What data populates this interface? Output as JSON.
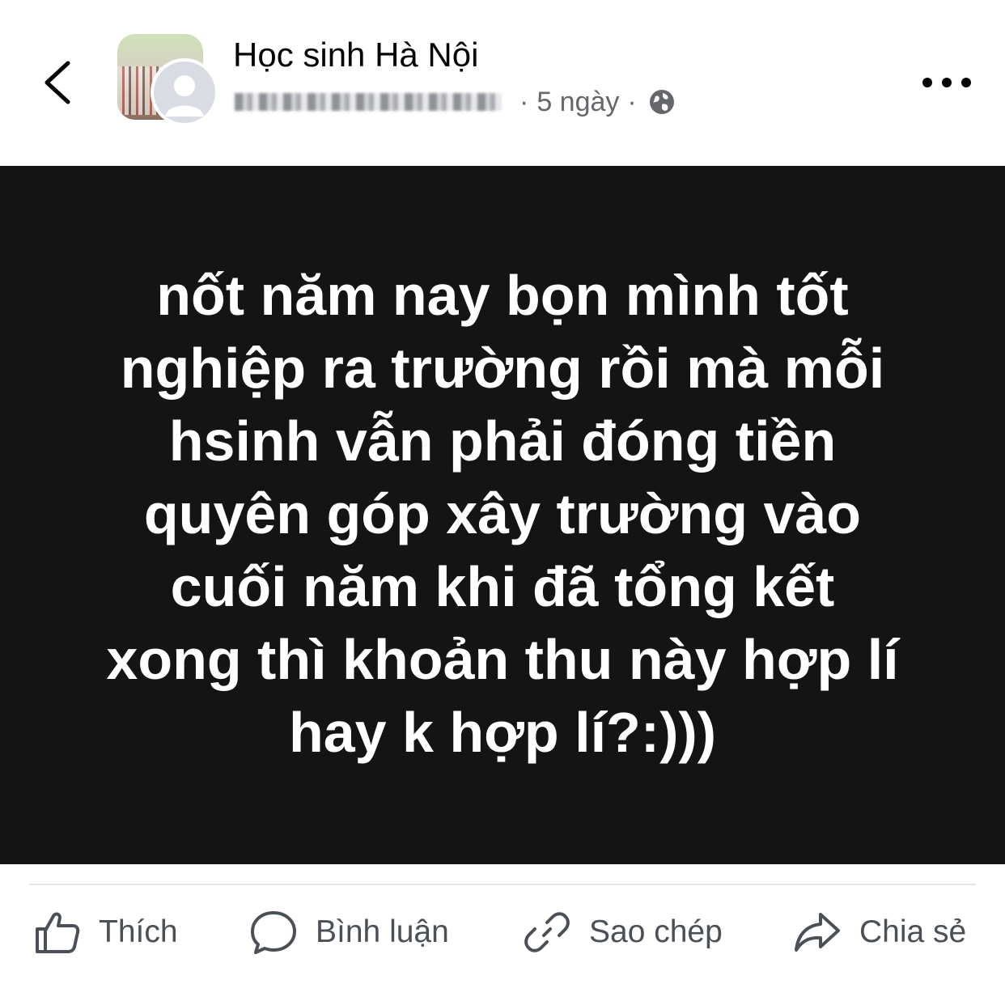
{
  "header": {
    "group_name": "Học sinh Hà Nội",
    "time_ago": "5 ngày",
    "separator": "·",
    "privacy_icon": "globe-icon",
    "back_icon": "chevron-left-icon",
    "more_icon": "more-horizontal-icon"
  },
  "post": {
    "lines": [
      "nốt năm nay bọn mình tốt",
      "nghiệp ra trường rồi mà mỗi",
      "hsinh vẫn phải đóng tiền",
      "quyên góp xây trường vào",
      "cuối năm khi đã tổng kết",
      "xong thì khoản thu này hợp lí",
      "hay k hợp lí?:)))"
    ],
    "background_color": "#141414",
    "text_color": "#ffffff"
  },
  "actions": {
    "like": {
      "label": "Thích",
      "icon": "thumbs-up-icon"
    },
    "comment": {
      "label": "Bình luận",
      "icon": "comment-bubble-icon"
    },
    "copy": {
      "label": "Sao chép",
      "icon": "link-icon"
    },
    "share": {
      "label": "Chia sẻ",
      "icon": "share-arrow-icon"
    }
  }
}
